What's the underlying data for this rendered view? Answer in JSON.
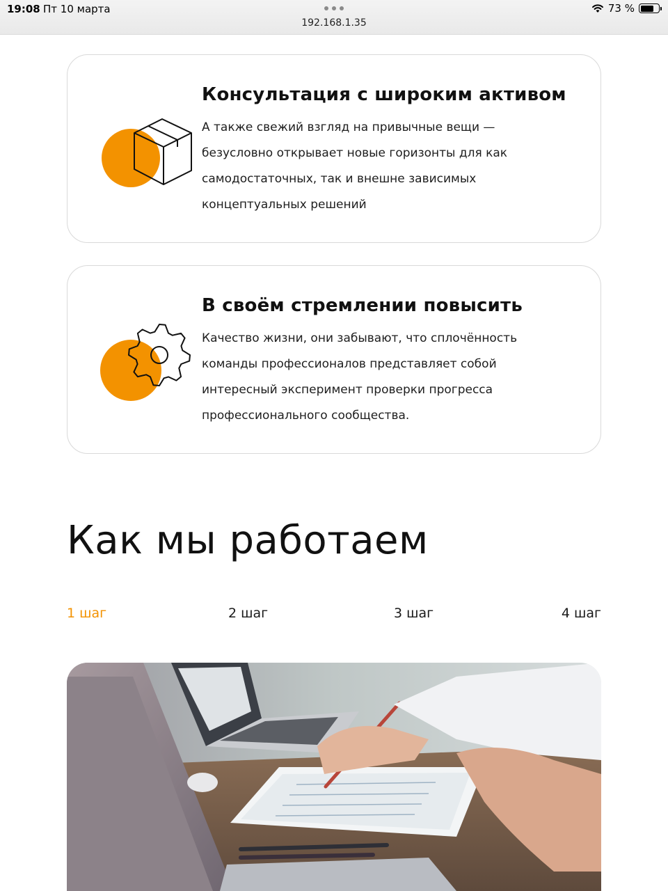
{
  "status_bar": {
    "time": "19:08",
    "date": "Пт 10 марта",
    "battery": "73 %",
    "battery_level": 0.73,
    "url": "192.168.1.35"
  },
  "cards": [
    {
      "title": "Консультация с широким активом",
      "lines": [
        "А также свежий взгляд на привычные вещи —",
        "безусловно открывает новые горизонты для как",
        "самодостаточных, так и внешне зависимых",
        "концептуальных решений"
      ],
      "icon": "box-icon"
    },
    {
      "title": "В своём стремлении повысить",
      "lines": [
        "Качество жизни, они забывают, что сплочённость",
        "команды профессионалов представляет собой",
        "интересный эксперимент проверки прогресса",
        "профессионального сообщества."
      ],
      "icon": "gear-icon"
    }
  ],
  "section": {
    "title": "Как мы работаем"
  },
  "steps": [
    {
      "label": "1 шаг",
      "active": true
    },
    {
      "label": "2 шаг",
      "active": false
    },
    {
      "label": "3 шаг",
      "active": false
    },
    {
      "label": "4 шаг",
      "active": false
    }
  ],
  "colors": {
    "accent": "#f39200",
    "card_border": "#d9d9d9",
    "text": "#111111"
  }
}
